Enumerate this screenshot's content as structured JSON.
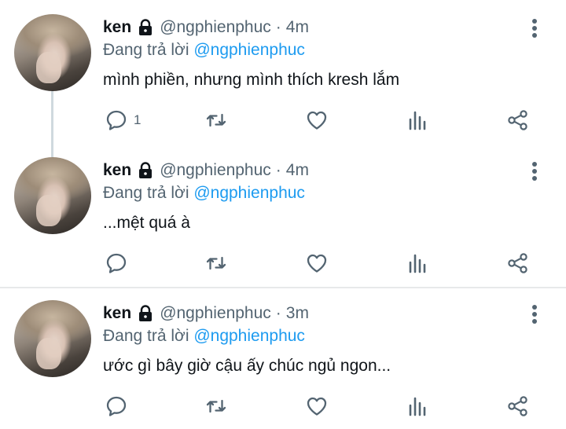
{
  "tweets": [
    {
      "name": "ken",
      "handle": "@ngphienphuc",
      "separator": "·",
      "time": "4m",
      "replying_prefix": "Đang trả lời",
      "replying_to": "@ngphienphuc",
      "text": "mình phiền, nhưng mình thích kresh lắm",
      "reply_count": "1"
    },
    {
      "name": "ken",
      "handle": "@ngphienphuc",
      "separator": "·",
      "time": "4m",
      "replying_prefix": "Đang trả lời",
      "replying_to": "@ngphienphuc",
      "text": "...mệt quá à",
      "reply_count": ""
    },
    {
      "name": "ken",
      "handle": "@ngphienphuc",
      "separator": "·",
      "time": "3m",
      "replying_prefix": "Đang trả lời",
      "replying_to": "@ngphienphuc",
      "text": "ước gì bây giờ cậu ấy chúc ngủ ngon...",
      "reply_count": ""
    }
  ],
  "icons": {
    "lock": "lock-icon",
    "more": "more-vertical-icon",
    "reply": "reply-icon",
    "retweet": "retweet-icon",
    "like": "heart-icon",
    "views": "views-icon",
    "share": "share-icon"
  },
  "colors": {
    "text": "#0f1419",
    "secondary": "#536471",
    "accent": "#1d9bf0",
    "divider": "#e7e9ea",
    "thread_line": "#cfd9de"
  }
}
